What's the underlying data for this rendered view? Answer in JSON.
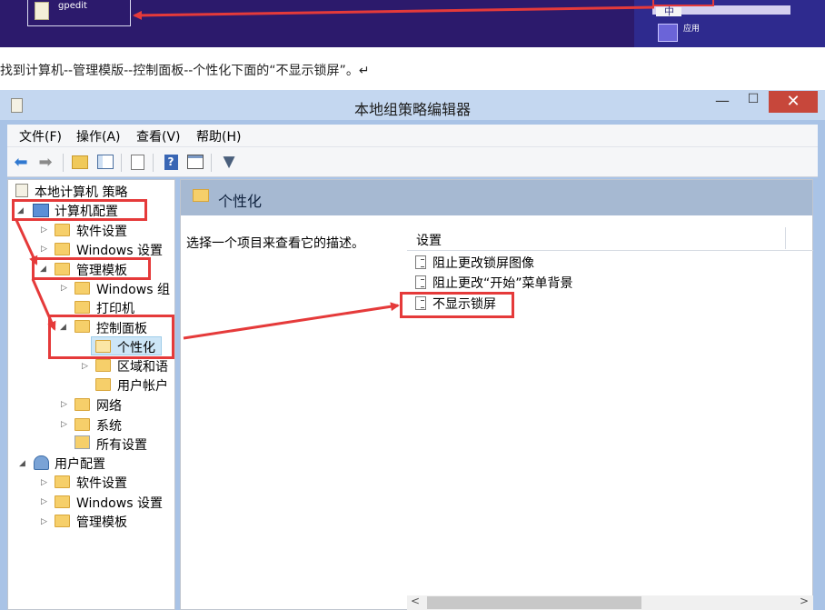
{
  "banner": {
    "file_label": "gpedit",
    "top_box_text": "中",
    "app_label": "应用",
    "file_icon": "document-icon",
    "app_icon": "keyboard-icon"
  },
  "instruction": "找到计算机--管理模版--控制面板--个性化下面的“不显示锁屏”。↵",
  "window": {
    "title": "本地组策略编辑器",
    "minimize": "—",
    "maximize": "☐",
    "close": "✕"
  },
  "menu": [
    "文件(F)",
    "操作(A)",
    "查看(V)",
    "帮助(H)"
  ],
  "toolbar": {
    "back": "back-arrow-icon",
    "forward": "forward-arrow-icon",
    "up": "folder-up-icon",
    "show_hide": "console-tree-icon",
    "export": "export-list-icon",
    "help": "help-icon",
    "properties": "properties-icon",
    "filter": "filter-icon"
  },
  "tree": {
    "root": "本地计算机 策略",
    "computer": "计算机配置",
    "software": "软件设置",
    "windows": "Windows 设置",
    "admin": "管理模板",
    "windows_comp": "Windows 组",
    "printer": "打印机",
    "control": "控制面板",
    "personal": "个性化",
    "region": "区域和语",
    "user_acct": "用户帐户",
    "network": "网络",
    "system": "系统",
    "all": "所有设置",
    "user": "用户配置",
    "u_software": "软件设置",
    "u_windows": "Windows 设置",
    "u_admin": "管理模板"
  },
  "details": {
    "header": "个性化",
    "description": "选择一个项目来查看它的描述。",
    "column": "设置",
    "items": [
      "阻止更改锁屏图像",
      "阻止更改“开始”菜单背景",
      "不显示锁屏"
    ]
  },
  "colors": {
    "highlight": "#e53a3a",
    "banner": "#2c1a6c"
  }
}
